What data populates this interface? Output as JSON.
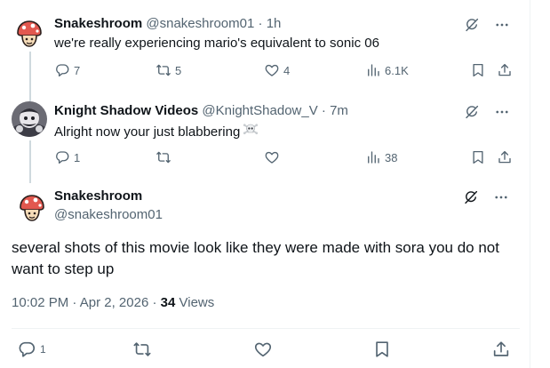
{
  "colors": {
    "text": "#0f1419",
    "secondary": "#536471",
    "border": "#eff3f4",
    "thread_line": "#cfd9de"
  },
  "reply1": {
    "name": "Snakeshroom",
    "handle": "@snakeshroom01",
    "separator": "·",
    "time": "1h",
    "text": "we're really experiencing mario's equivalent to sonic 06",
    "replies": "7",
    "reposts": "5",
    "likes": "4",
    "views": "6.1K"
  },
  "reply2": {
    "name": "Knight Shadow Videos",
    "handle": "@KnightShadow_V",
    "separator": "·",
    "time": "7m",
    "text": "Alright now your just blabbering",
    "emoji": "skull-and-crossbones",
    "replies": "1",
    "reposts": "",
    "likes": "",
    "views": "38"
  },
  "main": {
    "name": "Snakeshroom",
    "handle": "@snakeshroom01",
    "text": "several shots of this movie look like they were made with sora you do not want to step up",
    "time": "10:02 PM",
    "separator": "·",
    "date": "Apr 2, 2026",
    "views_count": "34",
    "views_label": "Views",
    "replies": "1"
  },
  "icons": [
    "grok-icon",
    "more-icon",
    "reply-icon",
    "repost-icon",
    "like-icon",
    "views-icon",
    "bookmark-icon",
    "share-icon"
  ]
}
